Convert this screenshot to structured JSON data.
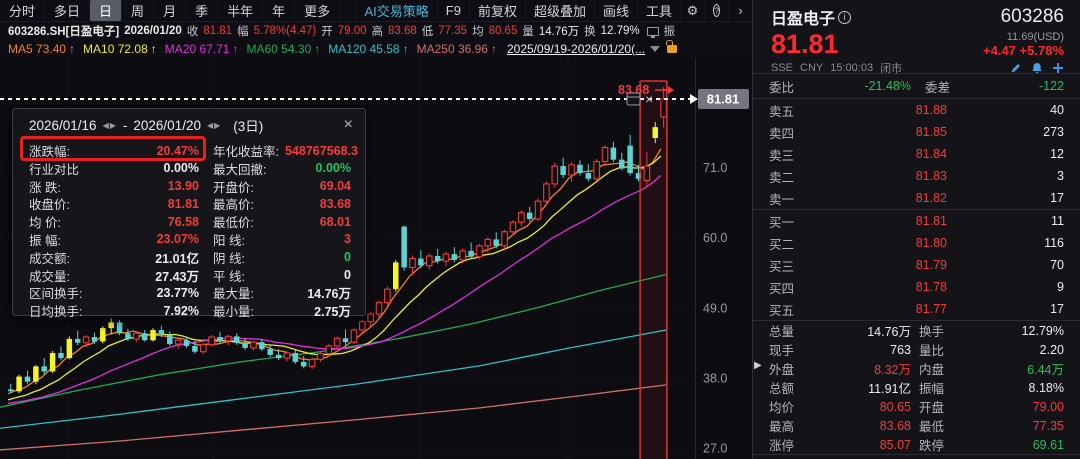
{
  "toolbar": {
    "tabs": [
      "分时",
      "多日",
      "日",
      "周",
      "月",
      "季",
      "半年",
      "年",
      "更多"
    ],
    "selected_tab": "日",
    "tools": [
      {
        "label": "AI交易策略",
        "accent": true
      },
      {
        "label": "F9",
        "accent": false
      },
      {
        "label": "前复权",
        "accent": false
      },
      {
        "label": "超级叠加",
        "accent": false
      },
      {
        "label": "画线",
        "accent": false
      },
      {
        "label": "工具",
        "accent": false
      }
    ],
    "gear_icon": "⚙",
    "help_icon": "?",
    "more_icon": "›"
  },
  "status_bar": {
    "code_label": "603286.SH[日盈电子]",
    "date": "2026/01/20",
    "fields": [
      {
        "label": "收",
        "value": "81.81",
        "color": "r"
      },
      {
        "label": "幅",
        "value": "5.78%(4.47)",
        "color": "r"
      },
      {
        "label": "开",
        "value": "79.00",
        "color": "r"
      },
      {
        "label": "高",
        "value": "83.68",
        "color": "r"
      },
      {
        "label": "低",
        "value": "77.35",
        "color": "r"
      },
      {
        "label": "均",
        "value": "80.65",
        "color": "r"
      },
      {
        "label": "量",
        "value": "14.76万",
        "color": "w"
      },
      {
        "label": "换",
        "value": "12.79%",
        "color": "w"
      }
    ],
    "clipped_label": "振"
  },
  "ma_bar": {
    "items": [
      {
        "label": "MA5",
        "value": "73.40",
        "arrow": "↑",
        "color": "#ef8428"
      },
      {
        "label": "MA10",
        "value": "72.08",
        "arrow": "↑",
        "color": "#ecec2f"
      },
      {
        "label": "MA20",
        "value": "67.71",
        "arrow": "↑",
        "color": "#df2fdf"
      },
      {
        "label": "MA60",
        "value": "54.30",
        "arrow": "↑",
        "color": "#1faa58"
      },
      {
        "label": "MA120",
        "value": "45.58",
        "arrow": "↑",
        "color": "#2fc2c8"
      },
      {
        "label": "MA250",
        "value": "36.96",
        "arrow": "↑",
        "color": "#cf6f6f"
      }
    ],
    "range_label": "2025/09/19-2026/01/20(..."
  },
  "popup": {
    "start_date": "2026/01/16",
    "end_date": "2026/01/20",
    "range_arrows": "◀▶",
    "dash": "-",
    "days_label": "(3日)",
    "close_icon": "×",
    "rows": [
      [
        "涨跌幅:",
        "20.47%",
        "r",
        "年化收益率:",
        "548767568.3",
        "r"
      ],
      [
        "行业对比",
        "0.00%",
        "w",
        "最大回撤:",
        "0.00%",
        "g"
      ],
      [
        "涨 跌:",
        "13.90",
        "r",
        "开盘价:",
        "69.04",
        "r"
      ],
      [
        "收盘价:",
        "81.81",
        "r",
        "最高价:",
        "83.68",
        "r"
      ],
      [
        "均 价:",
        "76.58",
        "r",
        "最低价:",
        "68.01",
        "r"
      ],
      [
        "振 幅:",
        "23.07%",
        "r",
        "阳 线:",
        "3",
        "r"
      ],
      [
        "成交额:",
        "21.01亿",
        "w",
        "阴 线:",
        "0",
        "g"
      ],
      [
        "成交量:",
        "27.43万",
        "w",
        "平 线:",
        "0",
        "w"
      ],
      [
        "区间换手:",
        "23.77%",
        "w",
        "最大量:",
        "14.76万",
        "w"
      ],
      [
        "日均换手:",
        "7.92%",
        "w",
        "最小量:",
        "2.75万",
        "w"
      ]
    ]
  },
  "right_panel": {
    "name": "日盈电子",
    "info_icon": "i",
    "code": "603286",
    "price": "81.81",
    "usd": "11.69(USD)",
    "change": "+4.47",
    "change_pct": "+5.78%",
    "exchange": "SSE",
    "currency": "CNY",
    "time": "15:00:03",
    "market_status": "闭市",
    "weibi": {
      "label1": "委比",
      "value1": "-21.48%",
      "label2": "委差",
      "value2": "-122"
    },
    "asks": [
      [
        "卖五",
        "81.88",
        "40"
      ],
      [
        "卖四",
        "81.85",
        "273"
      ],
      [
        "卖三",
        "81.84",
        "12"
      ],
      [
        "卖二",
        "81.83",
        "3"
      ],
      [
        "卖一",
        "81.82",
        "17"
      ]
    ],
    "bids": [
      [
        "买一",
        "81.81",
        "11"
      ],
      [
        "买二",
        "81.80",
        "116"
      ],
      [
        "买三",
        "81.79",
        "70"
      ],
      [
        "买四",
        "81.78",
        "9"
      ],
      [
        "买五",
        "81.77",
        "17"
      ]
    ],
    "stats": [
      [
        "总量",
        "14.76万",
        "w",
        "换手",
        "12.79%",
        "w"
      ],
      [
        "现手",
        "763",
        "w",
        "量比",
        "2.20",
        "w"
      ],
      [
        "外盘",
        "8.32万",
        "r",
        "内盘",
        "6.44万",
        "g"
      ],
      [
        "总额",
        "11.91亿",
        "w",
        "振幅",
        "8.18%",
        "w"
      ],
      [
        "均价",
        "80.65",
        "r",
        "开盘",
        "79.00",
        "r"
      ],
      [
        "最高",
        "83.68",
        "r",
        "最低",
        "77.35",
        "r"
      ],
      [
        "涨停",
        "85.07",
        "r",
        "跌停",
        "69.61",
        "g"
      ]
    ]
  },
  "chart_data": {
    "type": "candlestick",
    "symbol": "603286.SH",
    "visible_range": "2025/09/19-2026/01/20",
    "y_ticks": [
      71.0,
      60.0,
      49.0,
      38.0,
      27.0
    ],
    "grid_x": [
      68,
      213,
      420,
      568
    ],
    "price_line": 81.81,
    "current_price_label": "81.81",
    "high_annotation": "83.68",
    "selection": {
      "start_index": 76,
      "end_index": 78,
      "label": "(3日)"
    },
    "candles": [
      [
        36.3,
        37.2,
        35.8,
        36.0,
        "d"
      ],
      [
        36.0,
        38.6,
        35.7,
        38.3,
        "y"
      ],
      [
        38.3,
        39.2,
        37.2,
        37.5,
        "d"
      ],
      [
        37.5,
        40.1,
        37.1,
        39.9,
        "y"
      ],
      [
        39.9,
        41.2,
        38.6,
        39.1,
        "d"
      ],
      [
        39.1,
        42.3,
        38.9,
        42.0,
        "y"
      ],
      [
        42.0,
        43.0,
        40.8,
        41.2,
        "d"
      ],
      [
        41.2,
        44.6,
        41.0,
        44.2,
        "y"
      ],
      [
        44.2,
        45.5,
        43.2,
        43.6,
        "d"
      ],
      [
        43.6,
        44.8,
        42.9,
        44.5,
        "u"
      ],
      [
        44.5,
        45.2,
        43.4,
        43.8,
        "d"
      ],
      [
        43.8,
        46.2,
        43.5,
        45.9,
        "y"
      ],
      [
        45.9,
        47.4,
        45.0,
        46.8,
        "y"
      ],
      [
        46.8,
        47.2,
        44.8,
        45.1,
        "d"
      ],
      [
        45.1,
        45.8,
        43.9,
        44.2,
        "d"
      ],
      [
        44.2,
        45.5,
        43.7,
        45.1,
        "u"
      ],
      [
        45.1,
        45.6,
        43.8,
        44.0,
        "d"
      ],
      [
        44.0,
        45.9,
        43.8,
        45.6,
        "y"
      ],
      [
        45.6,
        46.3,
        44.5,
        44.9,
        "d"
      ],
      [
        44.9,
        45.4,
        43.1,
        43.4,
        "d"
      ],
      [
        43.4,
        44.4,
        42.6,
        44.0,
        "u"
      ],
      [
        44.0,
        44.6,
        42.8,
        43.1,
        "d"
      ],
      [
        43.1,
        43.9,
        41.9,
        42.2,
        "d"
      ],
      [
        42.2,
        43.6,
        41.8,
        43.3,
        "u"
      ],
      [
        43.3,
        44.8,
        43.0,
        44.5,
        "u"
      ],
      [
        44.5,
        45.3,
        43.6,
        43.9,
        "d"
      ],
      [
        43.9,
        44.9,
        43.2,
        44.6,
        "u"
      ],
      [
        44.6,
        45.1,
        43.3,
        43.6,
        "d"
      ],
      [
        43.6,
        44.3,
        42.5,
        42.8,
        "d"
      ],
      [
        42.8,
        43.9,
        42.4,
        43.7,
        "u"
      ],
      [
        43.7,
        44.2,
        42.3,
        42.6,
        "d"
      ],
      [
        42.6,
        43.3,
        41.4,
        41.7,
        "d"
      ],
      [
        41.7,
        42.6,
        40.9,
        41.2,
        "d"
      ],
      [
        41.2,
        42.3,
        40.7,
        42.0,
        "u"
      ],
      [
        42.0,
        42.5,
        40.3,
        40.6,
        "d"
      ],
      [
        40.6,
        41.5,
        39.6,
        39.9,
        "d"
      ],
      [
        39.9,
        41.3,
        39.5,
        41.0,
        "u"
      ],
      [
        41.0,
        42.2,
        40.6,
        41.9,
        "u"
      ],
      [
        41.9,
        43.4,
        41.5,
        43.1,
        "u"
      ],
      [
        43.1,
        44.6,
        42.7,
        44.3,
        "u"
      ],
      [
        44.3,
        45.7,
        43.2,
        43.7,
        "d"
      ],
      [
        43.7,
        45.9,
        43.4,
        45.6,
        "u"
      ],
      [
        45.6,
        47.2,
        45.1,
        46.9,
        "u"
      ],
      [
        46.9,
        48.4,
        46.0,
        48.1,
        "u"
      ],
      [
        48.1,
        50.2,
        47.6,
        49.9,
        "u"
      ],
      [
        49.9,
        52.4,
        49.5,
        52.0,
        "u"
      ],
      [
        52.0,
        56.6,
        51.6,
        56.2,
        "y"
      ],
      [
        61.8,
        62.0,
        54.9,
        55.4,
        "d"
      ],
      [
        55.4,
        57.3,
        54.2,
        56.8,
        "u"
      ],
      [
        56.8,
        58.1,
        55.3,
        55.7,
        "d"
      ],
      [
        55.7,
        57.6,
        55.1,
        57.2,
        "u"
      ],
      [
        57.2,
        58.3,
        56.0,
        56.4,
        "d"
      ],
      [
        56.4,
        57.9,
        55.6,
        57.5,
        "u"
      ],
      [
        57.5,
        58.6,
        56.2,
        56.6,
        "d"
      ],
      [
        56.6,
        58.4,
        56.1,
        58.0,
        "u"
      ],
      [
        58.0,
        59.3,
        56.8,
        57.1,
        "d"
      ],
      [
        57.1,
        59.1,
        56.7,
        58.8,
        "u"
      ],
      [
        58.8,
        60.2,
        57.8,
        59.8,
        "u"
      ],
      [
        59.8,
        60.9,
        58.4,
        58.8,
        "d"
      ],
      [
        58.8,
        61.3,
        58.3,
        61.0,
        "u"
      ],
      [
        61.0,
        62.8,
        60.4,
        62.5,
        "u"
      ],
      [
        62.5,
        64.4,
        61.8,
        64.0,
        "u"
      ],
      [
        64.0,
        64.9,
        62.6,
        63.0,
        "d"
      ],
      [
        63.0,
        66.2,
        62.7,
        65.8,
        "u"
      ],
      [
        65.8,
        68.9,
        65.3,
        68.5,
        "u"
      ],
      [
        68.5,
        71.8,
        67.9,
        71.3,
        "u"
      ],
      [
        71.3,
        72.6,
        69.4,
        69.9,
        "d"
      ],
      [
        69.9,
        71.9,
        68.8,
        71.5,
        "u"
      ],
      [
        71.5,
        72.2,
        69.8,
        70.2,
        "d"
      ],
      [
        70.2,
        71.6,
        68.9,
        69.3,
        "d"
      ],
      [
        69.3,
        72.4,
        69.0,
        72.0,
        "u"
      ],
      [
        72.0,
        74.6,
        71.3,
        74.2,
        "u"
      ],
      [
        74.2,
        75.1,
        71.9,
        72.3,
        "d"
      ],
      [
        72.3,
        73.4,
        70.6,
        70.9,
        "d"
      ],
      [
        74.5,
        76.2,
        69.8,
        70.2,
        "d"
      ],
      [
        70.2,
        71.5,
        68.9,
        69.3,
        "d"
      ],
      [
        69.04,
        73.5,
        68.01,
        71.3,
        "u"
      ],
      [
        75.7,
        78.2,
        74.9,
        77.4,
        "y"
      ],
      [
        79.0,
        83.68,
        77.35,
        81.81,
        "u"
      ]
    ],
    "ma_overlays": [
      {
        "name": "MA5",
        "window": 5,
        "seed": 35.5,
        "color": "#ef8428"
      },
      {
        "name": "MA10",
        "window": 10,
        "seed": 34.5,
        "color": "#ecec2f"
      },
      {
        "name": "MA20",
        "window": 20,
        "seed": 34.0,
        "color": "#df2fdf"
      }
    ],
    "ma_static": [
      {
        "name": "MA60",
        "color": "#1faa58",
        "points": [
          [
            0,
            33.5
          ],
          [
            80,
            36.2
          ],
          [
            160,
            38.6
          ],
          [
            240,
            40.6
          ],
          [
            320,
            42.2
          ],
          [
            400,
            44.3
          ],
          [
            470,
            46.5
          ],
          [
            540,
            49.2
          ],
          [
            600,
            51.8
          ],
          [
            666,
            54.3
          ]
        ]
      },
      {
        "name": "MA120",
        "color": "#2fc2c8",
        "points": [
          [
            0,
            30.2
          ],
          [
            120,
            32.4
          ],
          [
            240,
            34.8
          ],
          [
            360,
            37.2
          ],
          [
            480,
            40.0
          ],
          [
            570,
            42.8
          ],
          [
            666,
            45.6
          ]
        ]
      },
      {
        "name": "MA250",
        "color": "#cf6f6f",
        "points": [
          [
            0,
            26.8
          ],
          [
            120,
            28.2
          ],
          [
            240,
            29.9
          ],
          [
            360,
            31.6
          ],
          [
            480,
            33.4
          ],
          [
            580,
            35.3
          ],
          [
            666,
            37.0
          ]
        ]
      }
    ]
  }
}
